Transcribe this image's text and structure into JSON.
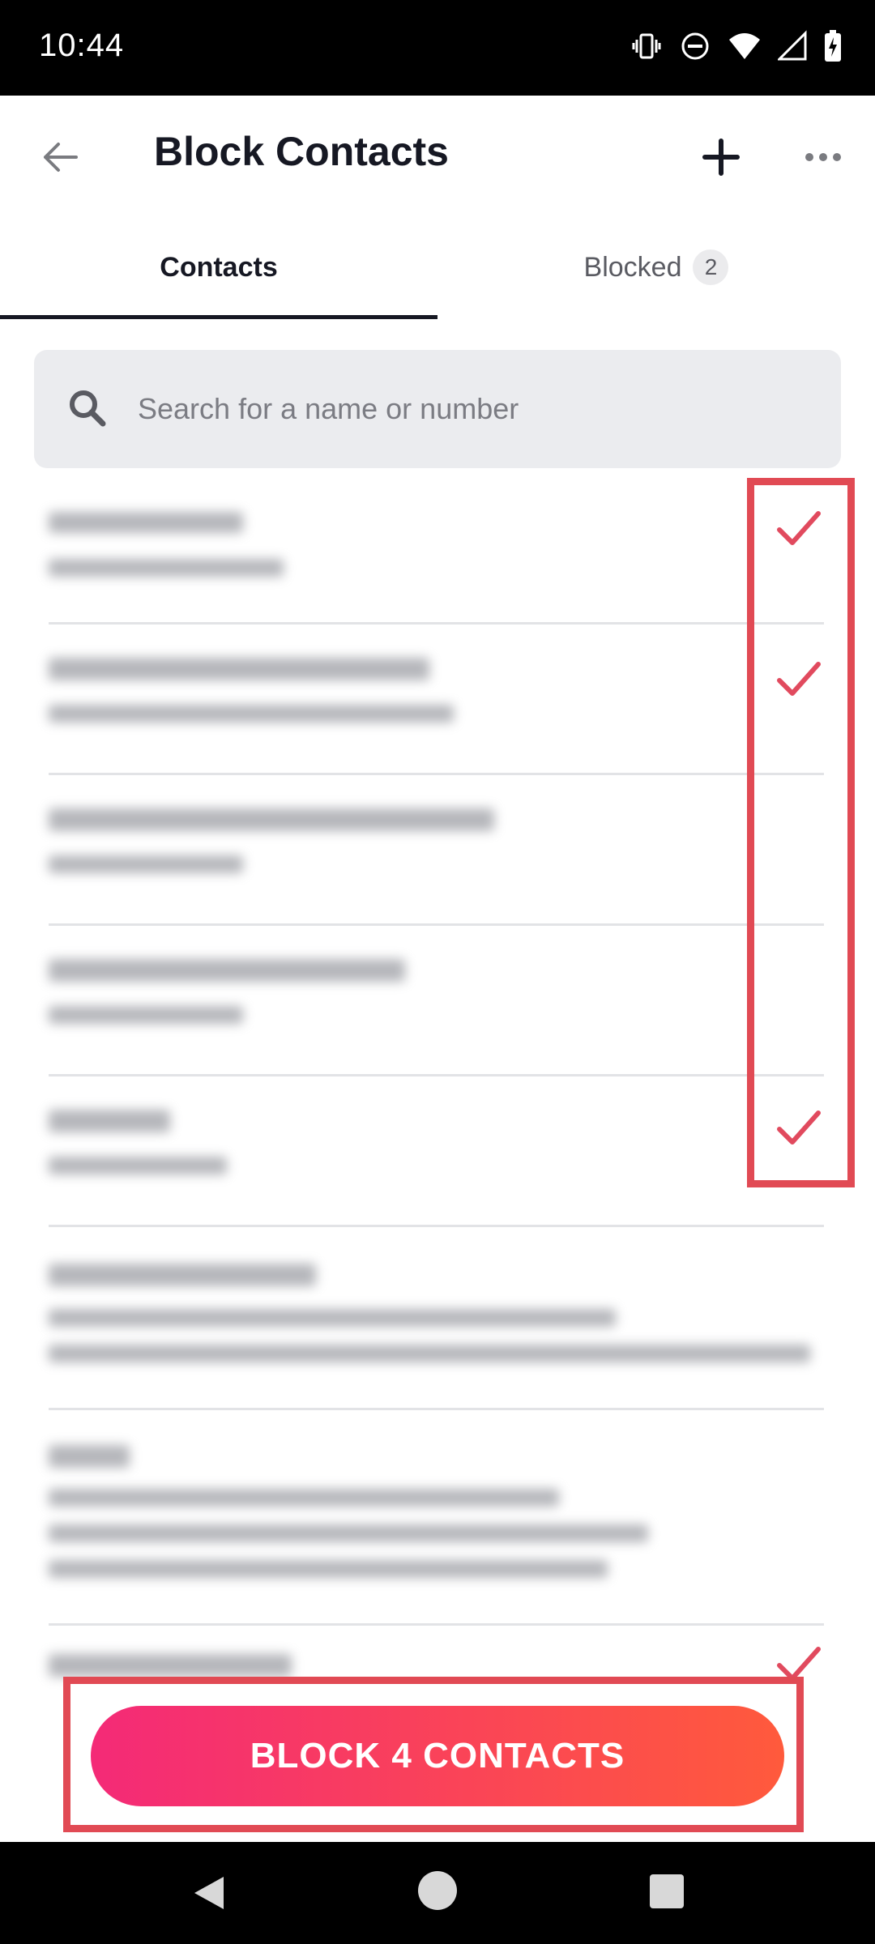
{
  "status_bar": {
    "time": "10:44"
  },
  "header": {
    "title": "Block Contacts"
  },
  "tabs": [
    {
      "label": "Contacts",
      "active": true
    },
    {
      "label": "Blocked",
      "badge": "2",
      "active": false
    }
  ],
  "search": {
    "placeholder": "Search for a name or number",
    "value": ""
  },
  "contacts": [
    {
      "selected": true
    },
    {
      "selected": true
    },
    {
      "selected": false
    },
    {
      "selected": false
    },
    {
      "selected": true
    },
    {
      "selected": false
    },
    {
      "selected": false
    },
    {
      "selected": true
    }
  ],
  "block_button": {
    "label": "BLOCK 4 CONTACTS"
  },
  "colors": {
    "accent": "#fe2c55",
    "check": "#e14a5e",
    "highlight": "#e14a54"
  }
}
